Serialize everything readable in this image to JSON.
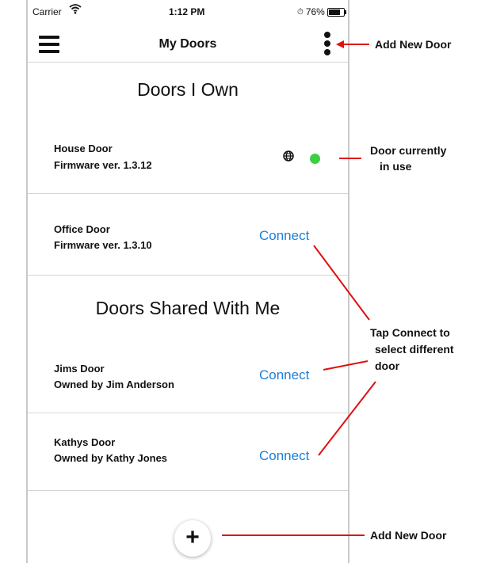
{
  "status_bar": {
    "carrier": "Carrier",
    "time": "1:12 PM",
    "battery": "76%",
    "battery_level": 0.76
  },
  "navbar": {
    "title": "My Doors",
    "menu_icon": "hamburger-menu-icon",
    "overflow_icon": "more-vertical-icon"
  },
  "owned_section": {
    "title": "Doors I Own",
    "doors": [
      {
        "name": "House Door",
        "sub": "Firmware ver. 1.3.12",
        "status": "in use",
        "status_color": "#3ccf46"
      },
      {
        "name": "Office Door",
        "sub": "Firmware ver. 1.3.10",
        "action": "Connect"
      }
    ]
  },
  "shared_section": {
    "title": "Doors Shared With Me",
    "doors": [
      {
        "name": "Jims Door",
        "sub": "Owned by Jim Anderson",
        "action": "Connect"
      },
      {
        "name": "Kathys Door",
        "sub": "Owned by Kathy Jones",
        "action": "Connect"
      }
    ]
  },
  "fab": {
    "label": "+"
  },
  "annotations": {
    "add_new_door_top": "Add New Door",
    "door_in_use_line1": "Door currently",
    "door_in_use_line2": "in use",
    "tap_connect_line1": "Tap Connect to",
    "tap_connect_line2": "select different",
    "tap_connect_line3": "door",
    "add_new_door_bottom": "Add New Door"
  },
  "colors": {
    "link": "#1e7fd8",
    "annotation_line": "#e01010",
    "status_green": "#3ccf46"
  }
}
